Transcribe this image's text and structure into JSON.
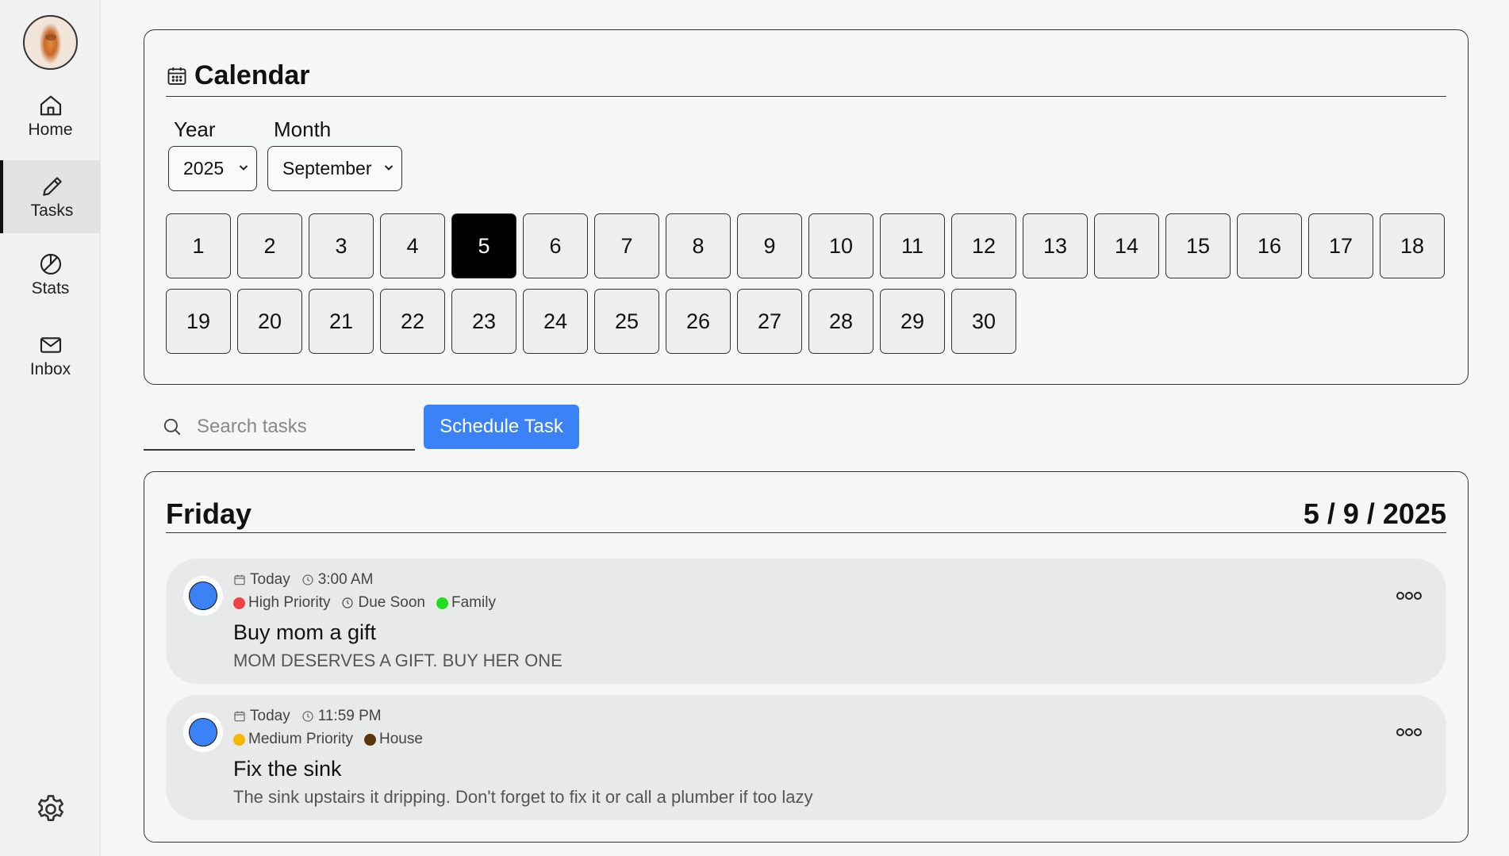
{
  "sidebar": {
    "items": [
      {
        "label": "Home",
        "icon": "home-icon"
      },
      {
        "label": "Tasks",
        "icon": "pencil-icon"
      },
      {
        "label": "Stats",
        "icon": "pie-chart-icon"
      },
      {
        "label": "Inbox",
        "icon": "mail-icon"
      }
    ],
    "active": "Tasks",
    "settings_icon": "gear-icon"
  },
  "calendar": {
    "title": "Calendar",
    "year_label": "Year",
    "month_label": "Month",
    "year_value": "2025",
    "month_value": "September",
    "days": [
      "1",
      "2",
      "3",
      "4",
      "5",
      "6",
      "7",
      "8",
      "9",
      "10",
      "11",
      "12",
      "13",
      "14",
      "15",
      "16",
      "17",
      "18",
      "19",
      "20",
      "21",
      "22",
      "23",
      "24",
      "25",
      "26",
      "27",
      "28",
      "29",
      "30"
    ],
    "selected_day": "5"
  },
  "search": {
    "placeholder": "Search tasks",
    "value": ""
  },
  "schedule_button": "Schedule Task",
  "day_view": {
    "day_name": "Friday",
    "date": "5 / 9 / 2025",
    "tasks": [
      {
        "date_label": "Today",
        "time": "3:00 AM",
        "tags": [
          {
            "label": "High Priority",
            "kind": "dot",
            "color": "#ef4444"
          },
          {
            "label": "Due Soon",
            "kind": "clock"
          },
          {
            "label": "Family",
            "kind": "dot",
            "color": "#22dd22"
          }
        ],
        "title": "Buy mom a gift",
        "description": "MOM DESERVES A GIFT. BUY HER ONE"
      },
      {
        "date_label": "Today",
        "time": "11:59 PM",
        "tags": [
          {
            "label": "Medium Priority",
            "kind": "dot",
            "color": "#f5b800"
          },
          {
            "label": "House",
            "kind": "dot",
            "color": "#5a3510"
          }
        ],
        "title": "Fix the sink",
        "description": "The sink upstairs it dripping. Don't forget to fix it or call a plumber if too lazy"
      }
    ]
  },
  "colors": {
    "accent": "#3b82f6",
    "selected_day_bg": "#000000",
    "task_check": "#3b82f6"
  }
}
